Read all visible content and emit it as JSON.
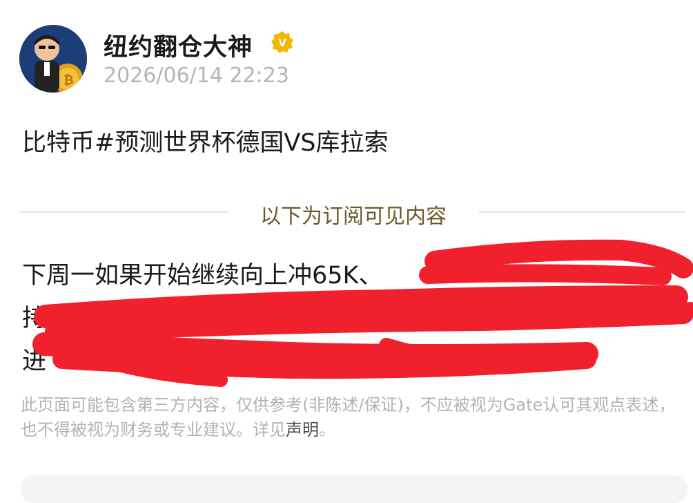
{
  "author": {
    "name": "纽约翻仓大神",
    "verified_badge": "V",
    "timestamp": "2026/06/14 22:23"
  },
  "post": {
    "title": "比特币#预测世界杯德国VS库拉索",
    "subscriber_label": "以下为订阅可见内容",
    "body_lines": [
      "下周一如果开始继续向上冲65K、",
      "持",
      "进"
    ]
  },
  "disclaimer": {
    "text": "此页面可能包含第三方内容，仅供参考(非陈述/保证)，不应被视为Gate认可其观点表述，也不得被视为财务或专业建议。详见",
    "link_label": "声明",
    "suffix": "。"
  },
  "colors": {
    "accent_gold": "#f2b705",
    "label_brown": "#6b5a28",
    "redaction_red": "#f0202c",
    "muted": "#b3b3b3"
  }
}
